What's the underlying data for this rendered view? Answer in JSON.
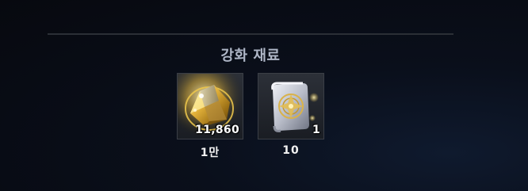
{
  "section": {
    "title": "강화 재료"
  },
  "materials": [
    {
      "icon": "gold-ore-icon",
      "owned": "11,860",
      "required": "1만"
    },
    {
      "icon": "enhancement-scroll-icon",
      "owned": "1",
      "required": "10"
    }
  ],
  "colors": {
    "title": "#aeb6c6",
    "slot_border": "#3a3e46",
    "gold": "#e8c24a",
    "scroll": "#c9ccd6"
  }
}
